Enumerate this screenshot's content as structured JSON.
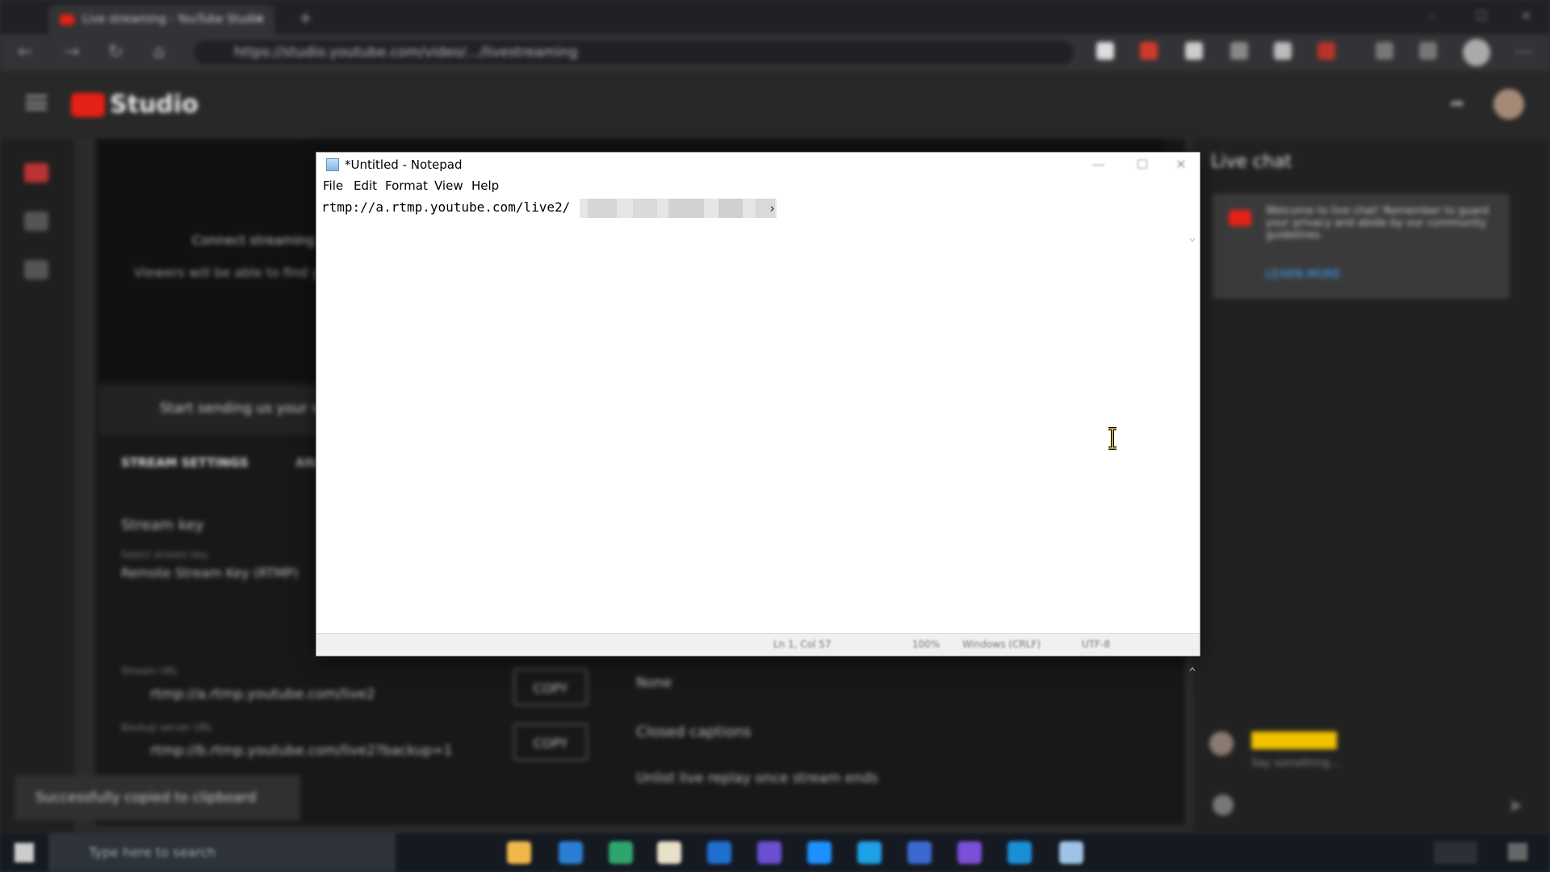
{
  "browser": {
    "tab_title": "Live streaming - YouTube Studio",
    "url": "https://studio.youtube.com/video/.../livestreaming"
  },
  "studio": {
    "logo_text": "Studio",
    "connect_text": "Connect streaming software to go live",
    "viewers_text": "Viewers will be able to find your stream",
    "start_text": "Start sending us your video from your streaming software",
    "tabs": [
      "STREAM SETTINGS",
      "ANALYTICS"
    ],
    "stream_key_heading": "Stream key",
    "select_key_label": "Select stream key",
    "stream_key_value": "Remote Stream Key (RTMP)",
    "stream_url_label": "Stream URL",
    "stream_url_value": "rtmp://a.rtmp.youtube.com/live2",
    "backup_url_label": "Backup server URL",
    "backup_url_value": "rtmp://b.rtmp.youtube.com/live2?backup=1",
    "copy_label": "COPY",
    "latency_value": "None",
    "closed_captions": "Closed captions",
    "unlist_replay": "Unlist live replay once stream ends",
    "toast": "Successfully copied to clipboard"
  },
  "live_chat": {
    "title": "Live chat",
    "welcome": "Welcome to live chat! Remember to guard your privacy and abide by our community guidelines.",
    "learn_more": "LEARN MORE",
    "placeholder": "Say something..."
  },
  "taskbar": {
    "search_placeholder": "Type here to search"
  },
  "notepad": {
    "title": "*Untitled - Notepad",
    "menu": [
      "File",
      "Edit",
      "Format",
      "View",
      "Help"
    ],
    "content": "rtmp://a.rtmp.youtube.com/live2/",
    "status": {
      "position": "Ln 1, Col 57",
      "zoom": "100%",
      "line_ending": "Windows (CRLF)",
      "encoding": "UTF-8"
    }
  },
  "colors": {
    "youtube_red": "#e62117",
    "studio_bg": "#181818",
    "notepad_bg": "#ffffff"
  }
}
